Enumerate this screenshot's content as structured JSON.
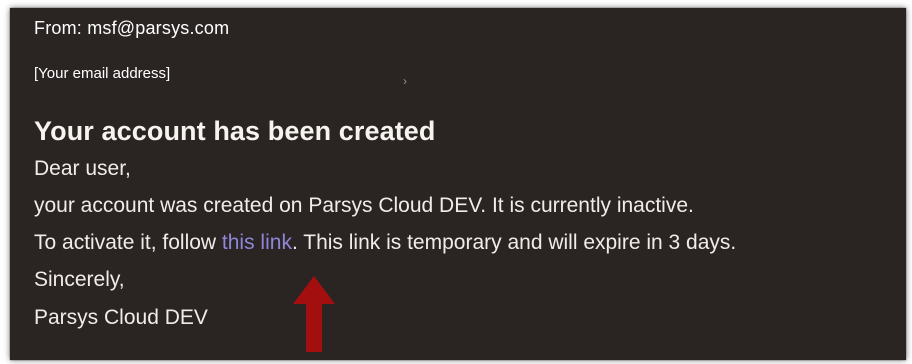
{
  "email": {
    "from_line": "From: msf@parsys.com",
    "to_line": "[Your email address]",
    "recipient_chevron": "›",
    "subject": "Your account has been created",
    "greeting": "Dear user,",
    "line_created": "your account was created on Parsys Cloud DEV. It is currently inactive.",
    "line_activate_prefix": "To activate it, follow ",
    "link_text": "this link",
    "line_activate_suffix": ". This link is temporary and will expire in 3 days.",
    "closing": "Sincerely,",
    "signature": "Parsys Cloud DEV"
  },
  "annotation": {
    "icon": "arrow-up-icon",
    "color": "#a30f0f"
  },
  "colors": {
    "panel_background": "#2a2523",
    "text": "#f0ece8",
    "link": "#8f86d8"
  }
}
